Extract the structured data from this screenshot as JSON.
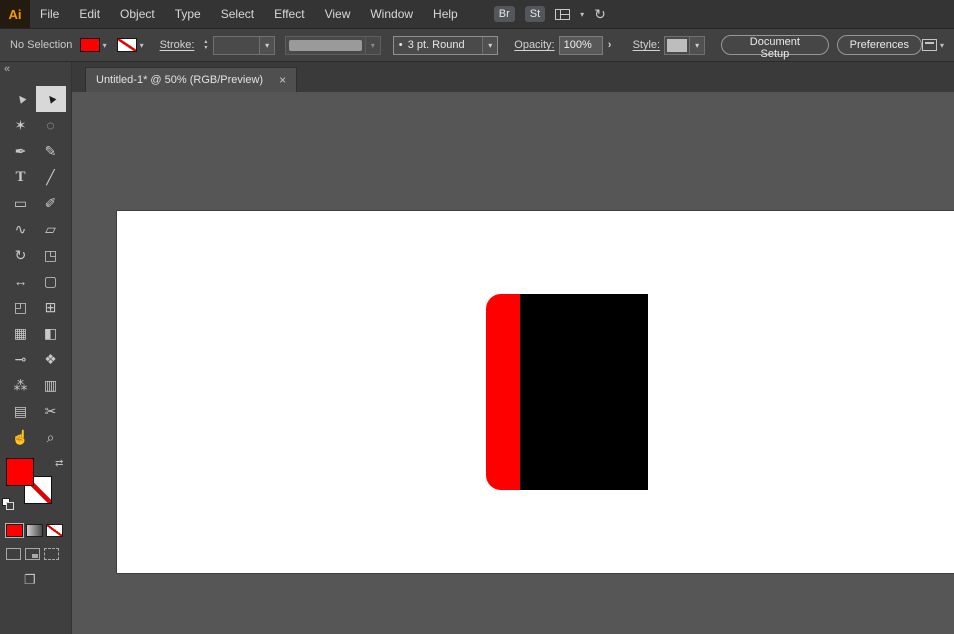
{
  "app": {
    "logo_text": "Ai",
    "menus": [
      "File",
      "Edit",
      "Object",
      "Type",
      "Select",
      "Effect",
      "View",
      "Window",
      "Help"
    ],
    "bridge_button": "Br",
    "stock_button": "St",
    "sync_glyph": "↻"
  },
  "control_bar": {
    "selection_status": "No Selection",
    "stroke_label": "Stroke:",
    "brush_bullet": "•",
    "brush_preset": "3 pt. Round",
    "opacity_label": "Opacity:",
    "opacity_value": "100%",
    "opacity_more_glyph": "›",
    "style_label": "Style:",
    "document_setup_button": "Document Setup",
    "preferences_button": "Preferences",
    "dropdown_glyph": "▾",
    "stepper_up_glyph": "▴",
    "stepper_down_glyph": "▾"
  },
  "tab_bar": {
    "active_tab": {
      "title": "Untitled-1* @ 50% (RGB/Preview)",
      "close_glyph": "×"
    }
  },
  "toolbar": {
    "collapse_glyph": "«",
    "swap_glyph": "⇄",
    "screen_mode_glyph": "❐",
    "tools": [
      {
        "name": "selection-tool",
        "glyph": "►"
      },
      {
        "name": "direct-selection-tool",
        "glyph": "►",
        "selected": true
      },
      {
        "name": "magic-wand-tool",
        "glyph": "✶"
      },
      {
        "name": "lasso-tool",
        "glyph": "◌"
      },
      {
        "name": "pen-tool",
        "glyph": "✒"
      },
      {
        "name": "curvature-tool",
        "glyph": "✎"
      },
      {
        "name": "type-tool",
        "glyph": "T"
      },
      {
        "name": "line-segment-tool",
        "glyph": "╱"
      },
      {
        "name": "rectangle-tool",
        "glyph": "▭"
      },
      {
        "name": "paintbrush-tool",
        "glyph": "✐"
      },
      {
        "name": "shaper-tool",
        "glyph": "∿"
      },
      {
        "name": "eraser-tool",
        "glyph": "▱"
      },
      {
        "name": "rotate-tool",
        "glyph": "↻"
      },
      {
        "name": "scale-tool",
        "glyph": "◳"
      },
      {
        "name": "width-tool",
        "glyph": "↔"
      },
      {
        "name": "free-transform-tool",
        "glyph": "▢"
      },
      {
        "name": "shape-builder-tool",
        "glyph": "◰"
      },
      {
        "name": "perspective-grid-tool",
        "glyph": "⊞"
      },
      {
        "name": "mesh-tool",
        "glyph": "▦"
      },
      {
        "name": "gradient-tool",
        "glyph": "◧"
      },
      {
        "name": "eyedropper-tool",
        "glyph": "⊸"
      },
      {
        "name": "blend-tool",
        "glyph": "❖"
      },
      {
        "name": "symbol-sprayer-tool",
        "glyph": "⁂"
      },
      {
        "name": "column-graph-tool",
        "glyph": "▥"
      },
      {
        "name": "artboard-tool",
        "glyph": "▤"
      },
      {
        "name": "slice-tool",
        "glyph": "✂"
      },
      {
        "name": "hand-tool",
        "glyph": "☝"
      },
      {
        "name": "zoom-tool",
        "glyph": "⌕"
      }
    ]
  },
  "canvas": {
    "artboard_color": "#ffffff",
    "shapes": [
      {
        "name": "red-rounded-rectangle",
        "fill": "#ff0000"
      },
      {
        "name": "black-rectangle",
        "fill": "#000000"
      }
    ]
  },
  "colors": {
    "fill_red": "#ff0000",
    "stroke_none_slash": "#e00000",
    "menubar_bg": "#343434",
    "panel_bg": "#3f3f3f",
    "canvas_bg": "#565656",
    "logo_orange": "#ff9a00"
  }
}
